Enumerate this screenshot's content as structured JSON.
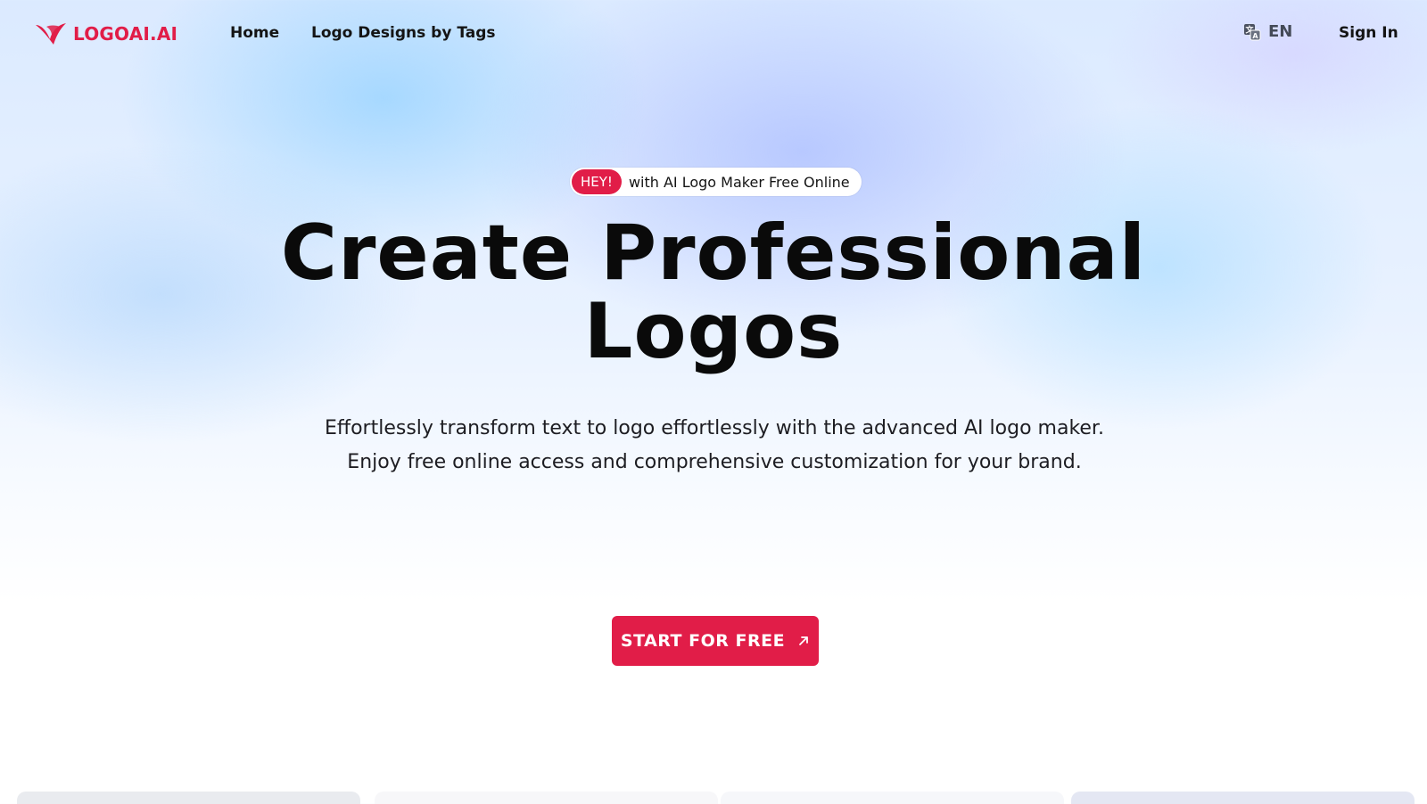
{
  "brand": {
    "name": "LOGOAI.AI",
    "color": "#e11d48"
  },
  "nav": {
    "home": "Home",
    "tags": "Logo Designs by Tags",
    "language": "EN",
    "sign_in": "Sign In"
  },
  "hero": {
    "badge": "HEY!",
    "badge_text": "with AI Logo Maker Free Online",
    "title_line1": "Create Professional",
    "title_line2": "Logos",
    "subtitle": "Effortlessly transform text to logo effortlessly with the advanced AI logo maker. Enjoy free online access and comprehensive customization for your brand.",
    "cta": "START FOR FREE"
  },
  "icons": {
    "logo": "bird-logo-icon",
    "language": "translate-icon",
    "cta": "arrow-up-right-icon"
  }
}
